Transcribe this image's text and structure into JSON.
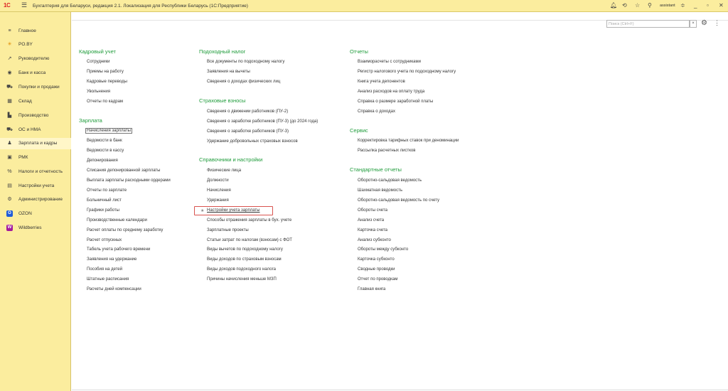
{
  "window": {
    "logo": "1С",
    "title": "Бухгалтерия для Беларуси, редакция 2.1. Локализация для Республики Беларусь   (1С:Предприятие)",
    "user": "assistant"
  },
  "sidebar": {
    "items": [
      {
        "label": "Главное",
        "icon": "≡"
      },
      {
        "label": "PO.BY",
        "icon": "✳"
      },
      {
        "label": "Руководителю",
        "icon": "↗"
      },
      {
        "label": "Банк и касса",
        "icon": "◉"
      },
      {
        "label": "Покупки и продажи",
        "icon": "⛟"
      },
      {
        "label": "Склад",
        "icon": "▦"
      },
      {
        "label": "Производство",
        "icon": "▙"
      },
      {
        "label": "ОС и НМА",
        "icon": "⛟"
      },
      {
        "label": "Зарплата и кадры",
        "icon": "♟"
      },
      {
        "label": "РМК",
        "icon": "▣"
      },
      {
        "label": "Налоги и отчетность",
        "icon": "%"
      },
      {
        "label": "Настройки учета",
        "icon": "▤"
      },
      {
        "label": "Администрирование",
        "icon": "⚙"
      },
      {
        "label": "OZON",
        "icon": "O"
      },
      {
        "label": "Wildberries",
        "icon": "W"
      }
    ]
  },
  "search": {
    "placeholder": "Поиск (Ctrl+F)"
  },
  "columns": {
    "col1": {
      "sec1": {
        "title": "Кадровый учет",
        "links": [
          "Сотрудники",
          "Приемы на работу",
          "Кадровые переводы",
          "Увольнения",
          "Отчеты по кадрам"
        ]
      },
      "sec2": {
        "title": "Зарплата",
        "links": [
          "Начисления зарплаты",
          "Ведомости в банк",
          "Ведомости в кассу",
          "Депонирования",
          "Списания депонированной зарплаты",
          "Выплата зарплаты расходными ордерами",
          "Отчеты по зарплате",
          "Больничный лист",
          "Графики работы",
          "Производственные календари",
          "Расчет оплаты по среднему заработку",
          "Расчет отпускных",
          "Табель учета рабочего времени",
          "Заявления на удержание",
          "Пособия на детей",
          "Штатные расписания",
          "Расчеты дней компенсации"
        ]
      }
    },
    "col2": {
      "sec1": {
        "title": "Подоходный налог",
        "links": [
          "Все документы по подоходному налогу",
          "Заявления на вычеты",
          "Сведения о доходах физических лиц"
        ]
      },
      "sec2": {
        "title": "Страховые взносы",
        "links": [
          "Сведения о движении работников (ПУ-2)",
          "Сведения о заработке работников (ПУ-3) (до 2024 года)",
          "Сведения о заработке работников (ПУ-3)",
          "Удержание добровольных страховых взносов"
        ]
      },
      "sec3": {
        "title": "Справочники и настройки",
        "links": [
          "Физические лица",
          "Должности",
          "Начисления",
          "Удержания",
          "Настройки учета зарплаты",
          "Способы отражения зарплаты в бух. учете",
          "Зарплатные проекты",
          "Статьи затрат по налогам (взносам) с ФОТ",
          "Виды вычетов по подоходному налогу",
          "Виды доходов по страховым взносам",
          "Виды доходов подоходного налога",
          "Причины начисления меньше МЗП"
        ]
      }
    },
    "col3": {
      "sec1": {
        "title": "Отчеты",
        "links": [
          "Взаиморасчеты с сотрудниками",
          "Регистр налогового учета по подоходному налогу",
          "Книга учета депонентов",
          "Анализ расходов на оплату труда",
          "Справка о размере заработной платы",
          "Справка о доходах"
        ]
      },
      "sec2": {
        "title": "Сервис",
        "links": [
          "Корректировка тарифных ставок при деноминации",
          "Рассылка расчетных листков"
        ]
      },
      "sec3": {
        "title": "Стандартные отчеты",
        "links": [
          "Оборотно-сальдовая ведомость",
          "Шахматная ведомость",
          "Оборотно-сальдовая ведомость по счету",
          "Обороты счета",
          "Анализ счета",
          "Карточка счета",
          "Анализ субконто",
          "Обороты между субконто",
          "Карточка субконто",
          "Сводные проводки",
          "Отчет по проводкам",
          "Главная книга"
        ]
      }
    }
  }
}
